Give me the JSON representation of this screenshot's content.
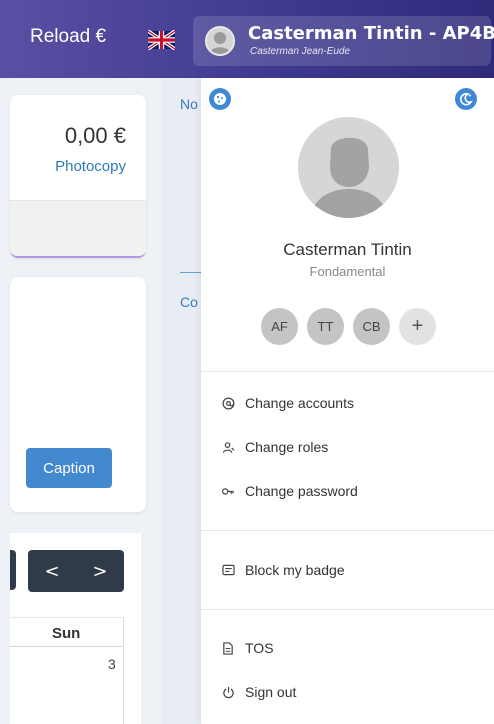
{
  "header": {
    "reload_label": "Reload €",
    "language_flag": "uk-flag-icon",
    "user": {
      "name": "Casterman Tintin - AP4B",
      "subtitle": "Casterman Jean-Eude"
    }
  },
  "background": {
    "balance_amount": "0,00 €",
    "balance_type": "Photocopy",
    "caption_button": "Caption",
    "nav_prev": "<",
    "nav_next": ">",
    "calendar_day_header": "Sun",
    "calendar_day_number": "3",
    "partial_heading_1": "No",
    "partial_heading_2": "Co"
  },
  "dropdown": {
    "left_corner_icon": "cookie-icon",
    "right_corner_icon": "moon-icon",
    "profile": {
      "name": "Casterman Tintin",
      "role": "Fondamental"
    },
    "accounts": [
      "AF",
      "TT",
      "CB"
    ],
    "add_account_label": "+",
    "menu": {
      "change_accounts": "Change accounts",
      "change_roles": "Change roles",
      "change_password": "Change password",
      "block_badge": "Block my badge",
      "tos": "TOS",
      "sign_out": "Sign out"
    }
  },
  "colors": {
    "header_start": "#5a4fa3",
    "header_end": "#2f2a7a",
    "accent_blue": "#3f88d6",
    "caption_button": "#4389d0",
    "dark_nav": "#2f3b4a"
  }
}
